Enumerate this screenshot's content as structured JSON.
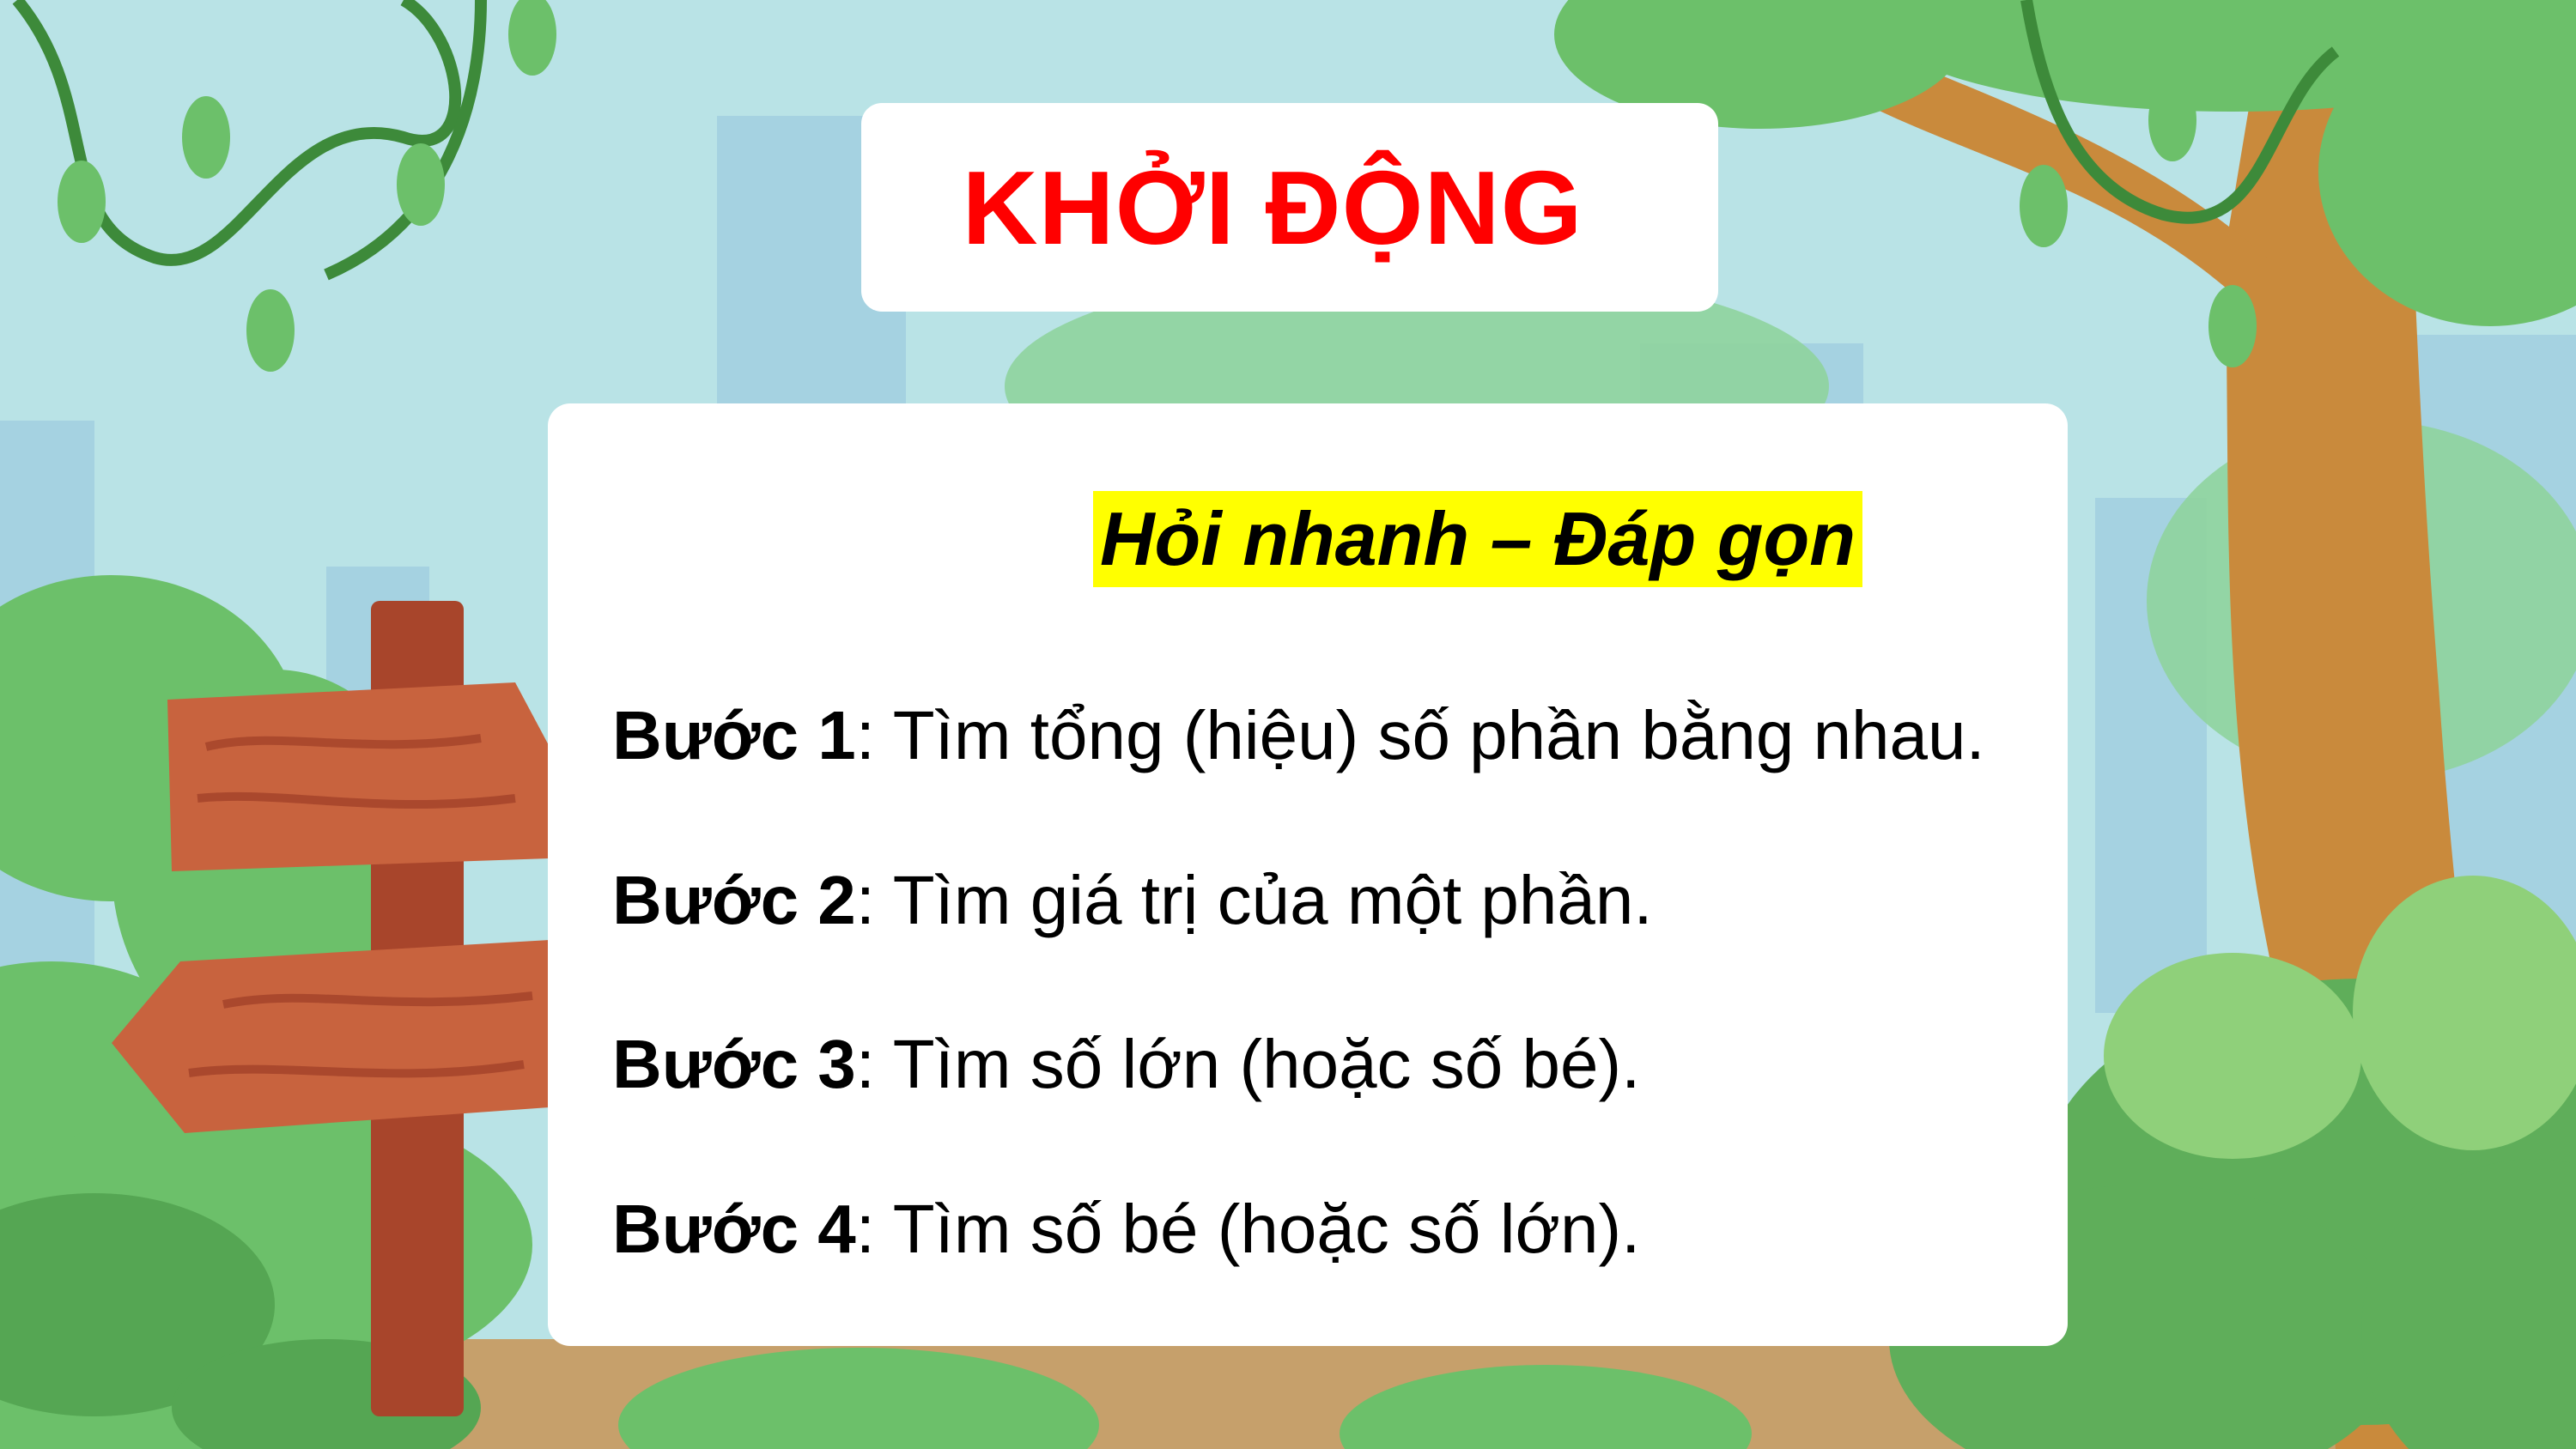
{
  "slide": {
    "title": "KHỞI ĐỘNG",
    "subtitle": "Hỏi nhanh – Đáp gọn",
    "steps": [
      {
        "label": "Bước 1",
        "text": ": Tìm tổng (hiệu) số phần bằng nhau."
      },
      {
        "label": "Bước 2",
        "text": ": Tìm giá trị của một phần."
      },
      {
        "label": "Bước 3",
        "text": ": Tìm số lớn (hoặc số bé)."
      },
      {
        "label": "Bước 4",
        "text": ": Tìm số bé (hoặc số lớn)."
      }
    ]
  },
  "colors": {
    "title": "#ff0000",
    "subtitle_highlight": "#ffff00",
    "sky": "#b9e3e6",
    "foliage": "#6cc06a",
    "trunk": "#c98a3c",
    "signpost": "#c8633e"
  },
  "decorations": [
    "vine-icon",
    "tree-trunk",
    "signpost-icon",
    "bush",
    "city-skyline"
  ]
}
